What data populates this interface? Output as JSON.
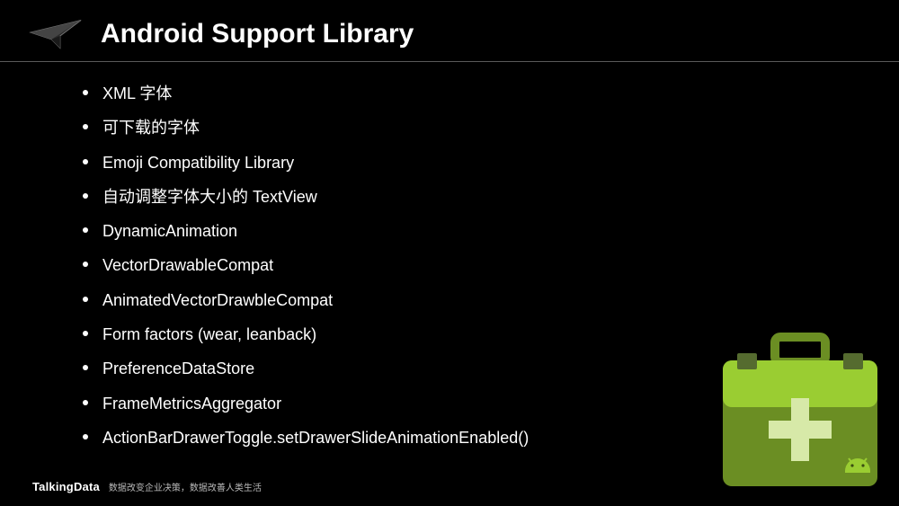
{
  "slide": {
    "title": "Android Support Library",
    "bullets": [
      "XML 字体",
      "可下载的字体",
      "Emoji Compatibility Library",
      "自动调整字体大小的 TextView",
      "DynamicAnimation",
      "VectorDrawableCompat",
      "AnimatedVectorDrawbleCompat",
      "Form factors (wear, leanback)",
      "PreferenceDataStore",
      "FrameMetricsAggregator",
      "ActionBarDrawerToggle.setDrawerSlideAnimationEnabled()"
    ]
  },
  "footer": {
    "brand": "TalkingData",
    "tagline": "数据改变企业决策，数据改善人类生活"
  },
  "icons": {
    "slide_logo": "paper-plane-icon",
    "decorative": "medical-case-android-icon"
  },
  "colors": {
    "background": "#000000",
    "text": "#ffffff",
    "accent_green_light": "#9ACD32",
    "accent_green": "#6B8E23",
    "accent_green_dark": "#556B2F"
  }
}
